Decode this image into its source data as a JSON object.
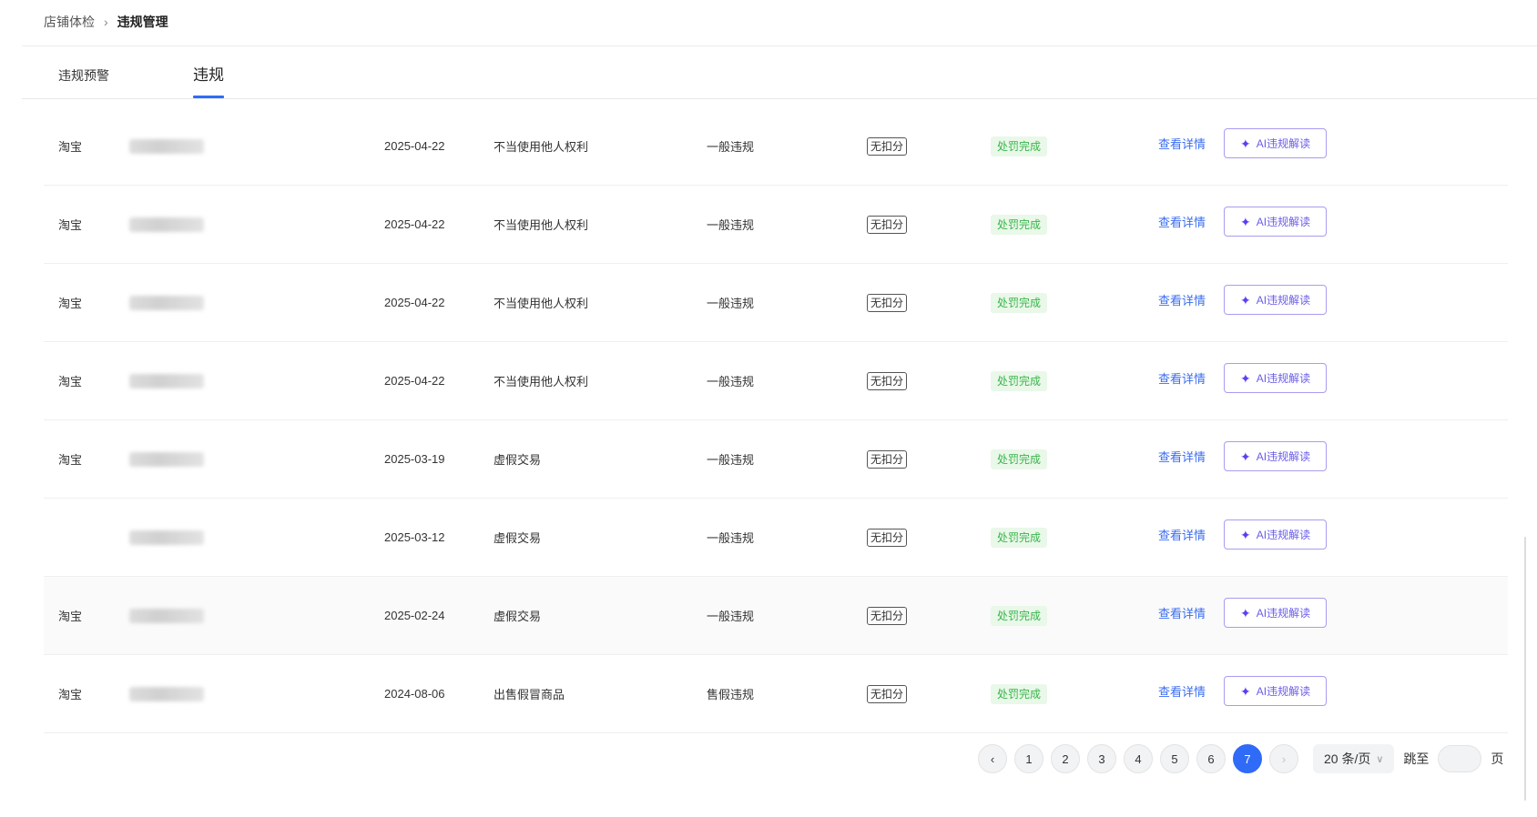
{
  "breadcrumb": {
    "items": [
      "店铺体检",
      "违规管理"
    ],
    "separator": "›"
  },
  "tabs": [
    {
      "label": "违规预警",
      "active": false
    },
    {
      "label": "违规",
      "active": true
    }
  ],
  "table": {
    "rows": [
      {
        "platform": "淘宝",
        "date": "2025-04-22",
        "reason": "不当使用他人权利",
        "level": "一般违规",
        "points": "无扣分",
        "status": "处罚完成",
        "detail": "查看详情",
        "ai_label": "AI违规解读"
      },
      {
        "platform": "淘宝",
        "date": "2025-04-22",
        "reason": "不当使用他人权利",
        "level": "一般违规",
        "points": "无扣分",
        "status": "处罚完成",
        "detail": "查看详情",
        "ai_label": "AI违规解读"
      },
      {
        "platform": "淘宝",
        "date": "2025-04-22",
        "reason": "不当使用他人权利",
        "level": "一般违规",
        "points": "无扣分",
        "status": "处罚完成",
        "detail": "查看详情",
        "ai_label": "AI违规解读"
      },
      {
        "platform": "淘宝",
        "date": "2025-04-22",
        "reason": "不当使用他人权利",
        "level": "一般违规",
        "points": "无扣分",
        "status": "处罚完成",
        "detail": "查看详情",
        "ai_label": "AI违规解读"
      },
      {
        "platform": "淘宝",
        "date": "2025-03-19",
        "reason": "虚假交易",
        "level": "一般违规",
        "points": "无扣分",
        "status": "处罚完成",
        "detail": "查看详情",
        "ai_label": "AI违规解读"
      },
      {
        "platform": "",
        "date": "2025-03-12",
        "reason": "虚假交易",
        "level": "一般违规",
        "points": "无扣分",
        "status": "处罚完成",
        "detail": "查看详情",
        "ai_label": "AI违规解读"
      },
      {
        "platform": "淘宝",
        "date": "2025-02-24",
        "reason": "虚假交易",
        "level": "一般违规",
        "points": "无扣分",
        "status": "处罚完成",
        "detail": "查看详情",
        "ai_label": "AI违规解读"
      },
      {
        "platform": "淘宝",
        "date": "2024-08-06",
        "reason": "出售假冒商品",
        "level": "售假违规",
        "points": "无扣分",
        "status": "处罚完成",
        "detail": "查看详情",
        "ai_label": "AI违规解读"
      }
    ],
    "hover_row": 6
  },
  "pagination": {
    "prev_icon": "chevron-left-icon",
    "next_icon": "chevron-right-icon",
    "pages": [
      "1",
      "2",
      "3",
      "4",
      "5",
      "6",
      "7"
    ],
    "current_page": "7",
    "page_size_label": "20 条/页",
    "jump_label": "跳至",
    "jump_value": "",
    "page_unit": "页"
  },
  "colors": {
    "accent": "#2f6bf6",
    "status_green": "#39b54a",
    "ai_purple": "#6a5ce8"
  }
}
